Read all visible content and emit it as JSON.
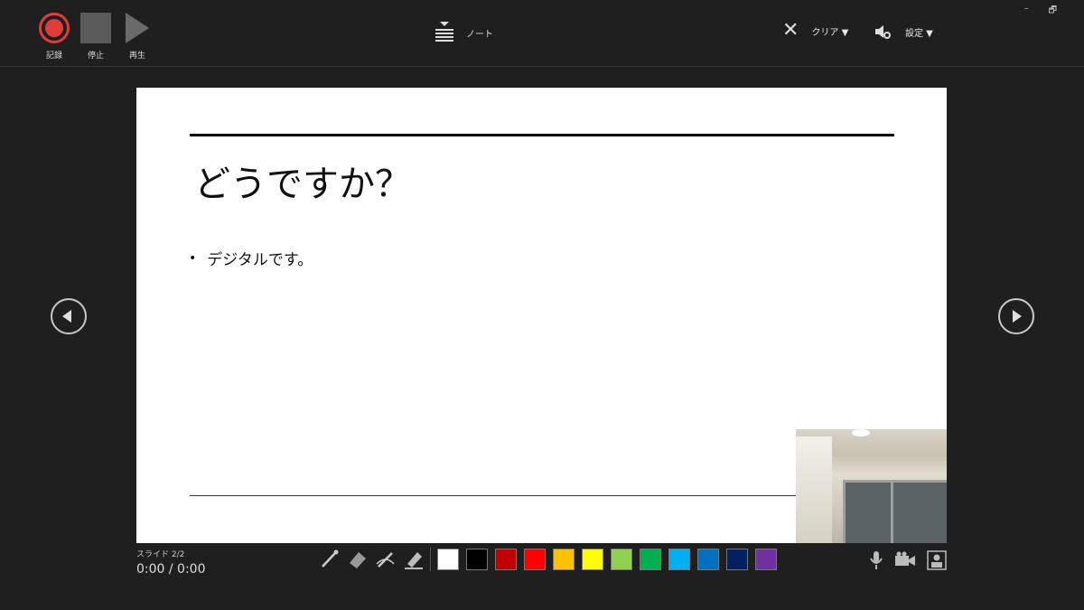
{
  "toolbar": {
    "record_label": "記録",
    "stop_label": "停止",
    "play_label": "再生",
    "notes_label": "ノート",
    "clear_label": "クリア ▼",
    "settings_label": "設定 ▼"
  },
  "window_controls": {
    "minimize": "–",
    "restore": "🗗"
  },
  "slide": {
    "title": "どうですか？",
    "bullet_mark": "•",
    "bullet": "デジタルです。"
  },
  "status": {
    "slide_number": "スライド 2/2",
    "timer": "0:00 / 0:00"
  },
  "pen_tools": [
    "pen-icon",
    "eraser-icon",
    "pen-variant-icon",
    "highlighter-icon"
  ],
  "colors": [
    "#ffffff",
    "#000000",
    "#c00000",
    "#ff0000",
    "#ffc000",
    "#ffff00",
    "#92d050",
    "#00b050",
    "#00b0f0",
    "#0070c0",
    "#002060",
    "#7030a0"
  ],
  "media_icons": [
    "microphone-icon",
    "video-camera-icon",
    "camera-preview-icon"
  ]
}
